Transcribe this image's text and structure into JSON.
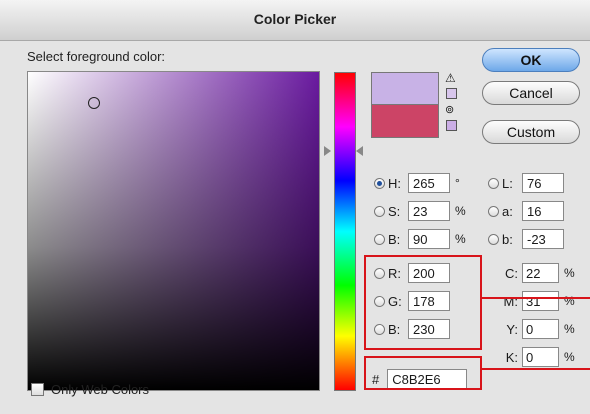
{
  "window": {
    "title": "Color Picker"
  },
  "picker": {
    "prompt": "Select foreground color:"
  },
  "buttons": {
    "ok": "OK",
    "cancel": "Cancel",
    "custom": "Custom"
  },
  "swatches": {
    "new_color": "#c8b2e6",
    "current_color": "#cc4466"
  },
  "hsb": {
    "h": {
      "label": "H:",
      "value": "265",
      "unit": "°"
    },
    "s": {
      "label": "S:",
      "value": "23",
      "unit": "%"
    },
    "b": {
      "label": "B:",
      "value": "90",
      "unit": "%"
    }
  },
  "lab": {
    "l": {
      "label": "L:",
      "value": "76"
    },
    "a": {
      "label": "a:",
      "value": "16"
    },
    "b": {
      "label": "b:",
      "value": "-23"
    }
  },
  "rgb": {
    "r": {
      "label": "R:",
      "value": "200"
    },
    "g": {
      "label": "G:",
      "value": "178"
    },
    "b": {
      "label": "B:",
      "value": "230"
    }
  },
  "cmyk": {
    "c": {
      "label": "C:",
      "value": "22",
      "unit": "%"
    },
    "m": {
      "label": "M:",
      "value": "31",
      "unit": "%"
    },
    "y": {
      "label": "Y:",
      "value": "0",
      "unit": "%"
    },
    "k": {
      "label": "K:",
      "value": "0",
      "unit": "%"
    }
  },
  "hex": {
    "label": "#",
    "value": "C8B2E6"
  },
  "options": {
    "only_web_colors": "Only Web Colors"
  }
}
